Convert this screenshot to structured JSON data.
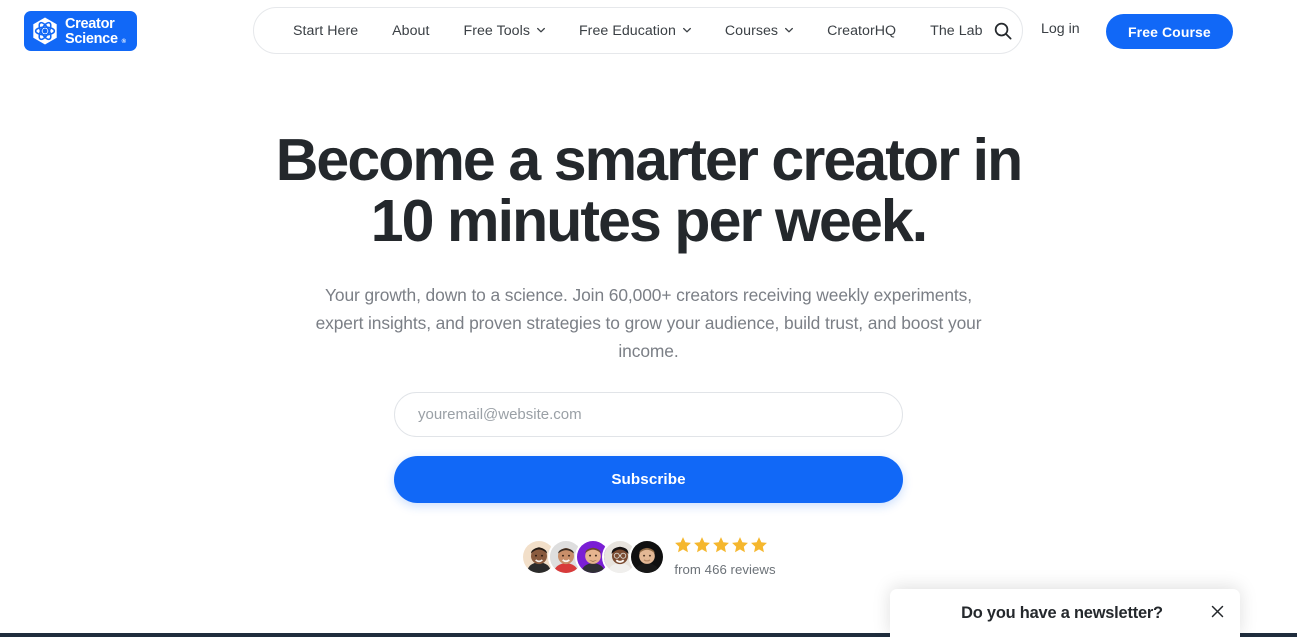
{
  "header": {
    "logo": {
      "line1": "Creator",
      "line2": "Science",
      "registered": "®",
      "icon": "atom-hexagon-icon",
      "color": "#1168F7"
    },
    "nav": [
      {
        "label": "Start Here",
        "has_caret": false
      },
      {
        "label": "About",
        "has_caret": false
      },
      {
        "label": "Free Tools",
        "has_caret": true
      },
      {
        "label": "Free Education",
        "has_caret": true
      },
      {
        "label": "Courses",
        "has_caret": true
      },
      {
        "label": "CreatorHQ",
        "has_caret": false
      },
      {
        "label": "The Lab",
        "has_caret": false
      }
    ],
    "search_icon": "search-icon",
    "login_label": "Log in",
    "cta_label": "Free Course"
  },
  "hero": {
    "headline_line1": "Become a smarter creator in",
    "headline_line2": "10 minutes per week.",
    "subhead": "Your growth, down to a science. Join 60,000+ creators receiving weekly experiments, expert insights, and proven strategies to grow your audience, build trust, and boost your income.",
    "email_placeholder": "youremail@website.com",
    "email_value": "",
    "subscribe_label": "Subscribe"
  },
  "social_proof": {
    "avatar_count": 5,
    "avatars": [
      {
        "name": "avatar-1",
        "bg": "#f2dfc9",
        "skin": "#8a5b3e",
        "shirt": "#2b2b2b",
        "hair": "#241a14"
      },
      {
        "name": "avatar-2",
        "bg": "#dedede",
        "skin": "#c98f6a",
        "shirt": "#d83b3b",
        "hair": "#3a2b20"
      },
      {
        "name": "avatar-3",
        "bg": "#7a1fd4",
        "skin": "#e6b48f",
        "shirt": "#2f2f35",
        "hair": "#6b4a2c"
      },
      {
        "name": "avatar-4",
        "bg": "#e8e4de",
        "skin": "#7a4a30",
        "shirt": "#f0efed",
        "hair": "#171212"
      },
      {
        "name": "avatar-5",
        "bg": "#101010",
        "skin": "#e3b895",
        "shirt": "#181818",
        "hair": "#8f6a45"
      }
    ],
    "star_count": 5,
    "star_color": "#F5B72E",
    "reviews_text": "from 466 reviews"
  },
  "popup": {
    "title": "Do you have a newsletter?",
    "close_icon": "close-icon"
  },
  "colors": {
    "brand_blue": "#1168F7",
    "text_dark": "#24282c",
    "text_muted": "#7b7f86",
    "border": "#e6e8eb",
    "bottom_bar": "#1f2d3d"
  }
}
